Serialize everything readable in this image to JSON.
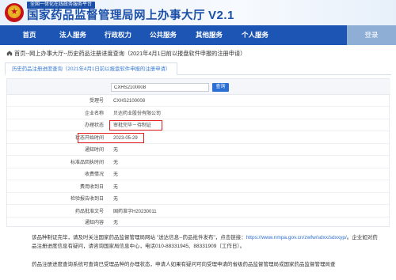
{
  "header": {
    "tag": "全国一体化在线政务服务平台",
    "title_main": "国家药品监督管理局",
    "title_sub": "网上办事大厅",
    "version": "V2.1"
  },
  "nav": {
    "items": [
      {
        "label": "首页"
      },
      {
        "label": "法人服务"
      },
      {
        "label": "行政权力"
      },
      {
        "label": "公共服务"
      },
      {
        "label": "其他服务"
      },
      {
        "label": "个人服务"
      }
    ],
    "login": "登录"
  },
  "breadcrumb": "首页--网上办事大厅--历史药品注册进度查询（2021年4月1日前以报盘软件申报的注册申请）",
  "tab": {
    "label": "历史药品注册进度查询（2021年4月1日前以报盘软件申报的注册申请）"
  },
  "search": {
    "value": "CXHS2100008",
    "button": "查询"
  },
  "rows": [
    {
      "label": "受理号",
      "value": "CXHS2100008"
    },
    {
      "label": "企业名称",
      "value": "贝达药业股份有限公司"
    },
    {
      "label": "办理状态",
      "value": "审批完毕－待制证"
    },
    {
      "label": "状态开始时间",
      "value": "2023-05-29"
    },
    {
      "label": "通知时间",
      "value": "无"
    },
    {
      "label": "标准品回执时间",
      "value": "无"
    },
    {
      "label": "收费情况",
      "value": "无"
    },
    {
      "label": "费用收到日",
      "value": "无"
    },
    {
      "label": "检验报告收到日",
      "value": "无"
    },
    {
      "label": "药品批准文号",
      "value": "国药准字H20230011"
    },
    {
      "label": "通知内容",
      "value": "无"
    }
  ],
  "notice": {
    "line1_prefix": "该品种制证完毕，请及时关注国家药品监督管理局网站 \"送达信息--药品批件发布\"，点击链接：",
    "link": "https://www.nmpa.gov.cn/zwfw/sdxx/sdxxyp/",
    "line1_suffix": "。企业如对药品注册进度信息有疑问，请咨询国家局信息中心，电话010-88331945、88331909（工作日）。",
    "line2": "药品注册进度查询系统可查询已受理品种的办理状态，申请人如果有疑问可向受理申请的省级药品监督管理局或国家药品监督管理局查"
  }
}
